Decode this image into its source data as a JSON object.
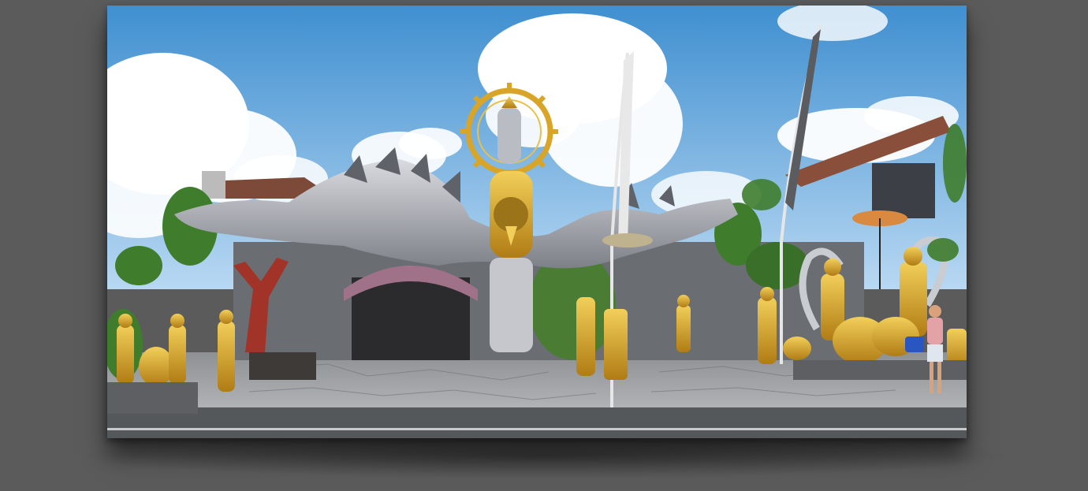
{
  "photo": {
    "subject": "balinese-temple-facade",
    "colors": {
      "sky_top": "#3f8fd0",
      "sky_bottom": "#a9cfee",
      "cloud": "#ffffff",
      "gold": "#d8a528",
      "stone_gray": "#8f9196",
      "dragon_silver": "#b9bcc2",
      "foliage": "#3f7d2d",
      "pavement": "#9a9da0",
      "road": "#55585b",
      "background": "#5b5b5b"
    }
  }
}
